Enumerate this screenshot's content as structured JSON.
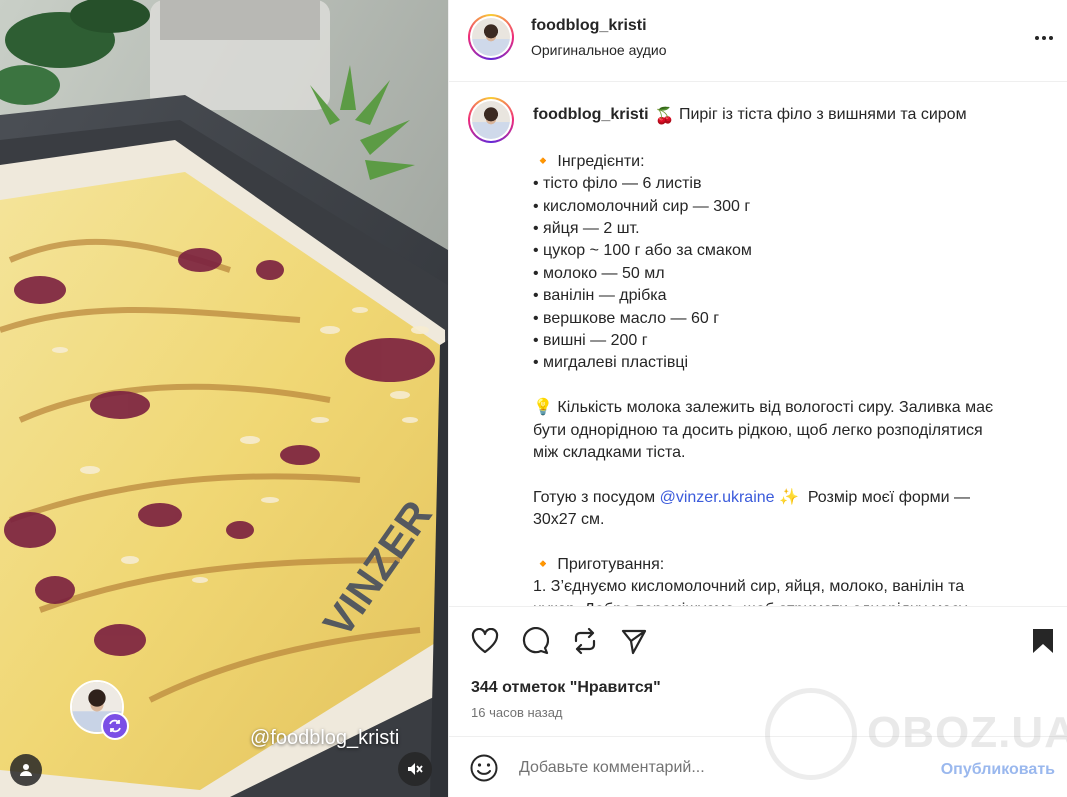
{
  "media": {
    "watermark_handle": "@foodblog_kristi",
    "pan_brand": "VINZER"
  },
  "header": {
    "username": "foodblog_kristi",
    "subtitle": "Оригинальное аудио"
  },
  "caption": {
    "username": "foodblog_kristi",
    "title_emoji": "🍒",
    "title": "Пиріг із тіста філо з вишнями та сиром",
    "lines": [
      "",
      "🔸 Інгредієнти:",
      "• тісто філо — 6 листів",
      "• кисломолочний сир — 300 г",
      "• яйця — 2 шт.",
      "• цукор ~ 100 г або за смаком",
      "• молоко — 50 мл",
      "• ванілін — дрібка",
      "• вершкове масло — 60 г",
      "• вишні — 200 г",
      "• мигдалеві пластівці",
      "",
      "💡 Кількість молока залежить від вологості сиру. Заливка має",
      "бути однорідною та досить рідкою, щоб легко розподілятися",
      "між складками тіста.",
      ""
    ],
    "vendor_prefix": "Готую з посудом ",
    "vendor_mention": "@vinzer.ukraine",
    "vendor_suffix": " ✨  Розмір моєї форми —",
    "vendor_line2": "30х27 см.",
    "lines_after": [
      "",
      "🔸 Приготування:",
      "1. З’єднуємо кисломолочний сир, яйця, молоко, ванілін та",
      "цукор. Добре перемішуємо, щоб отримати однорідну масу."
    ]
  },
  "actions": {
    "likes": "344 отметок \"Нравится\"",
    "time": "16 часов назад"
  },
  "comment": {
    "placeholder": "Добавьте комментарий...",
    "publish": "Опубликовать"
  },
  "site_mark": "OBOZ.UA",
  "colors": {
    "accent_link": "#3b5bdb",
    "publish_disabled": "#9ab8ee",
    "remix_badge": "#7b4fe6"
  }
}
